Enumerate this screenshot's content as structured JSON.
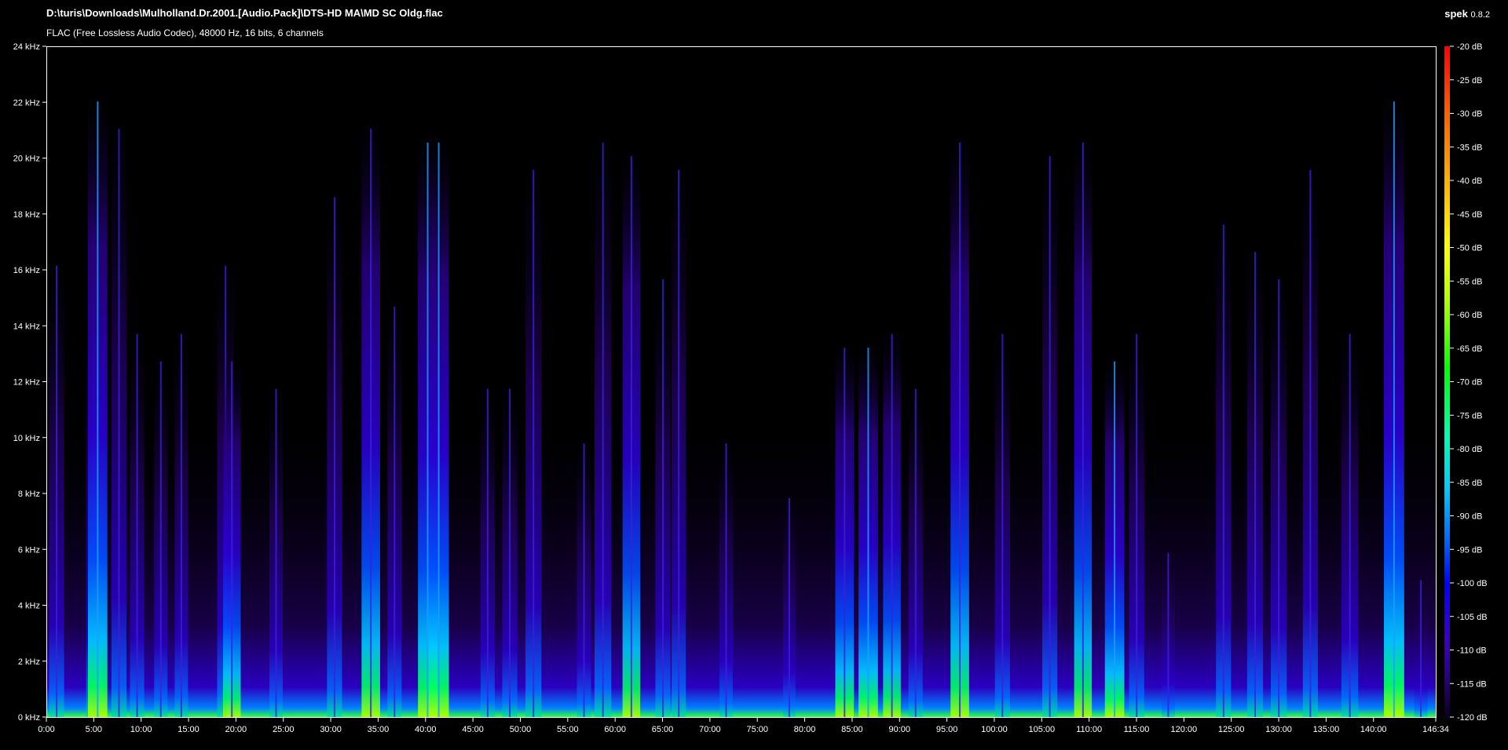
{
  "header": {
    "file_path": "D:\\turis\\Downloads\\Mulholland.Dr.2001.[Audio.Pack]\\DTS-HD MA\\MD SC Oldg.flac",
    "stream_info": "FLAC (Free Lossless Audio Codec), 48000 Hz, 16 bits, 6 channels",
    "app_name": "spek",
    "app_version": "0.8.2"
  },
  "chart_data": {
    "type": "heatmap",
    "title": "",
    "xlabel": "",
    "ylabel": "",
    "xlim": [
      0,
      8794
    ],
    "ylim": [
      0,
      24000
    ],
    "x_ticks": [
      "0:00",
      "5:00",
      "10:00",
      "15:00",
      "20:00",
      "25:00",
      "30:00",
      "35:00",
      "40:00",
      "45:00",
      "50:00",
      "55:00",
      "60:00",
      "65:00",
      "70:00",
      "75:00",
      "80:00",
      "85:00",
      "90:00",
      "95:00",
      "100:00",
      "105:00",
      "110:00",
      "115:00",
      "120:00",
      "125:00",
      "130:00",
      "135:00",
      "140:00",
      "146:34"
    ],
    "y_ticks": [
      "24 kHz",
      "22 kHz",
      "20 kHz",
      "18 kHz",
      "16 kHz",
      "14 kHz",
      "12 kHz",
      "10 kHz",
      "8 kHz",
      "6 kHz",
      "4 kHz",
      "2 kHz",
      "0 kHz"
    ],
    "colorbar_ticks": [
      "-20 dB",
      "-25 dB",
      "-30 dB",
      "-35 dB",
      "-40 dB",
      "-45 dB",
      "-50 dB",
      "-55 dB",
      "-60 dB",
      "-65 dB",
      "-70 dB",
      "-75 dB",
      "-80 dB",
      "-85 dB",
      "-90 dB",
      "-95 dB",
      "-100 dB",
      "-105 dB",
      "-110 dB",
      "-115 dB",
      "-120 dB"
    ],
    "colorbar_range_db": [
      -120,
      -20
    ],
    "colormap": [
      "#0a0020",
      "#2a0080",
      "#3a00c8",
      "#0000ff",
      "#0060ff",
      "#00c8ff",
      "#00ffb0",
      "#00ff00",
      "#b0ff00",
      "#ffff00",
      "#ffb000",
      "#ff6000",
      "#ff0000"
    ],
    "spectral_peaks": [
      {
        "t": 60,
        "f_khz": 16.5,
        "level": 0.6
      },
      {
        "t": 300,
        "f_khz": 14,
        "level": 0.7
      },
      {
        "t": 320,
        "f_khz": 22.5,
        "level": 0.85
      },
      {
        "t": 455,
        "f_khz": 21.5,
        "level": 0.6
      },
      {
        "t": 570,
        "f_khz": 14,
        "level": 0.55
      },
      {
        "t": 720,
        "f_khz": 13,
        "level": 0.5
      },
      {
        "t": 850,
        "f_khz": 14,
        "level": 0.5
      },
      {
        "t": 1130,
        "f_khz": 16.5,
        "level": 0.7
      },
      {
        "t": 1170,
        "f_khz": 13,
        "level": 0.75
      },
      {
        "t": 1450,
        "f_khz": 12,
        "level": 0.5
      },
      {
        "t": 1820,
        "f_khz": 19,
        "level": 0.6
      },
      {
        "t": 2050,
        "f_khz": 21.5,
        "level": 0.8
      },
      {
        "t": 2200,
        "f_khz": 15,
        "level": 0.55
      },
      {
        "t": 2410,
        "f_khz": 21,
        "level": 0.85
      },
      {
        "t": 2480,
        "f_khz": 21,
        "level": 0.9
      },
      {
        "t": 2790,
        "f_khz": 12,
        "level": 0.55
      },
      {
        "t": 2930,
        "f_khz": 12,
        "level": 0.6
      },
      {
        "t": 3080,
        "f_khz": 20,
        "level": 0.65
      },
      {
        "t": 3400,
        "f_khz": 10,
        "level": 0.55
      },
      {
        "t": 3520,
        "f_khz": 21,
        "level": 0.7
      },
      {
        "t": 3700,
        "f_khz": 20.5,
        "level": 0.75
      },
      {
        "t": 3900,
        "f_khz": 16,
        "level": 0.6
      },
      {
        "t": 4000,
        "f_khz": 20,
        "level": 0.55
      },
      {
        "t": 4300,
        "f_khz": 10,
        "level": 0.5
      },
      {
        "t": 4700,
        "f_khz": 8,
        "level": 0.45
      },
      {
        "t": 5050,
        "f_khz": 13.5,
        "level": 0.8
      },
      {
        "t": 5200,
        "f_khz": 13.5,
        "level": 0.85
      },
      {
        "t": 5350,
        "f_khz": 14,
        "level": 0.75
      },
      {
        "t": 5500,
        "f_khz": 12,
        "level": 0.55
      },
      {
        "t": 5780,
        "f_khz": 21,
        "level": 0.8
      },
      {
        "t": 6050,
        "f_khz": 14,
        "level": 0.6
      },
      {
        "t": 6350,
        "f_khz": 20.5,
        "level": 0.6
      },
      {
        "t": 6560,
        "f_khz": 21,
        "level": 0.75
      },
      {
        "t": 6760,
        "f_khz": 13,
        "level": 0.85
      },
      {
        "t": 6900,
        "f_khz": 14,
        "level": 0.6
      },
      {
        "t": 7100,
        "f_khz": 6,
        "level": 0.5
      },
      {
        "t": 7450,
        "f_khz": 18,
        "level": 0.6
      },
      {
        "t": 7650,
        "f_khz": 17,
        "level": 0.65
      },
      {
        "t": 7800,
        "f_khz": 16,
        "level": 0.65
      },
      {
        "t": 8000,
        "f_khz": 20,
        "level": 0.6
      },
      {
        "t": 8250,
        "f_khz": 14,
        "level": 0.7
      },
      {
        "t": 8530,
        "f_khz": 22.5,
        "level": 0.9
      },
      {
        "t": 8700,
        "f_khz": 5,
        "level": 0.5
      }
    ]
  }
}
